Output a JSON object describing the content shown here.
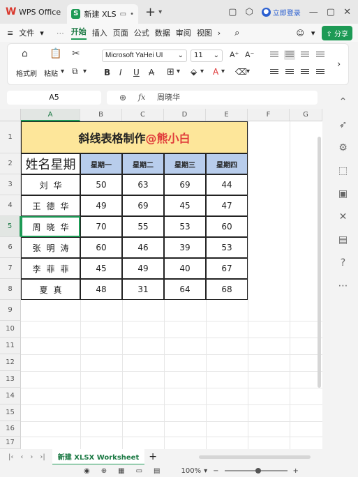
{
  "titlebar": {
    "app_tab": "WPS Office",
    "file_tab": "新建 XLS",
    "login": "立即登录"
  },
  "menu": {
    "file": "文件",
    "items": [
      "开始",
      "插入",
      "页面",
      "公式",
      "数据",
      "审阅",
      "视图"
    ],
    "active": "开始",
    "share": "分享"
  },
  "ribbon": {
    "format_painter": "格式刷",
    "paste": "粘贴",
    "font_name": "Microsoft YaHei UI",
    "font_size": "11"
  },
  "formula": {
    "cell_ref": "A5",
    "fx": "fx",
    "value": "周晓华"
  },
  "sheet": {
    "columns": [
      "A",
      "B",
      "C",
      "D",
      "E",
      "F",
      "G"
    ],
    "rows": [
      "1",
      "2",
      "3",
      "4",
      "5",
      "6",
      "7",
      "8",
      "9",
      "10",
      "11",
      "12",
      "13",
      "14",
      "15",
      "16",
      "17"
    ],
    "active_column": "A",
    "active_row": "5",
    "title_main": "斜线表格制作",
    "title_highlight": "@熊小白",
    "diag_header": "姓名星期",
    "weekdays": [
      "星期一",
      "星期二",
      "星期三",
      "星期四"
    ],
    "table": [
      {
        "name": "刘华",
        "values": [
          "50",
          "63",
          "69",
          "44"
        ]
      },
      {
        "name": "王德华",
        "values": [
          "49",
          "69",
          "45",
          "47"
        ]
      },
      {
        "name": "周晓华",
        "values": [
          "70",
          "55",
          "53",
          "60"
        ]
      },
      {
        "name": "张明涛",
        "values": [
          "60",
          "46",
          "39",
          "53"
        ]
      },
      {
        "name": "李菲菲",
        "values": [
          "45",
          "49",
          "40",
          "67"
        ]
      },
      {
        "name": "夏真",
        "values": [
          "48",
          "31",
          "64",
          "68"
        ]
      }
    ]
  },
  "tabs": {
    "sheet_name": "新建 XLSX Worksheet",
    "add": "+"
  },
  "status": {
    "zoom": "100%"
  },
  "colors": {
    "accent": "#1d9a55",
    "title_fill": "#fde69a",
    "header_fill": "#b8cdec",
    "highlight_text": "#e03a3a"
  }
}
